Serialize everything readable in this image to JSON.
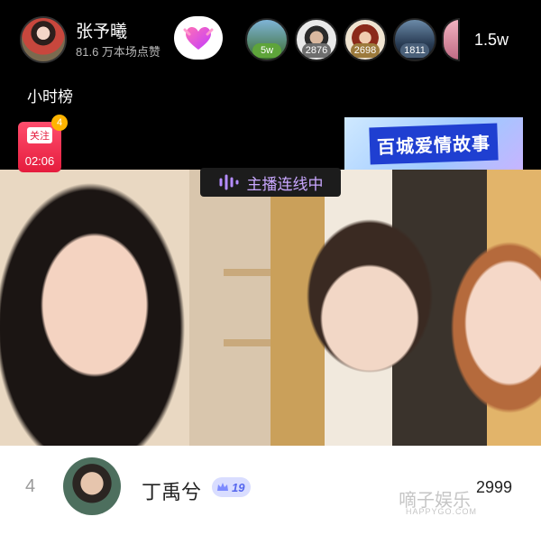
{
  "host": {
    "name": "张予曦",
    "likes": "81.6 万本场点赞"
  },
  "viewers": [
    {
      "badge": "5w"
    },
    {
      "badge": "2876"
    },
    {
      "badge": "2698"
    },
    {
      "badge": "1811"
    }
  ],
  "viewer_count": "1.5w",
  "rank_label": "小时榜",
  "follow": {
    "label": "关注",
    "timer": "02:06",
    "count": "4"
  },
  "event_banner": "百城爱情故事",
  "mic_banner": "主播连线中",
  "ranking_row": {
    "rank": "4",
    "name": "丁禹兮",
    "level": "19",
    "score": "2999"
  },
  "watermark": {
    "text": "嘀子娱乐",
    "sub": "HAPPYGO.COM"
  },
  "colors": {
    "accent_purple": "#c9a7ff",
    "follow_red": "#e51c3d",
    "level_blue": "#5566ee"
  },
  "icons": [
    "heart-icon",
    "voice-wave-icon",
    "crown-icon"
  ]
}
